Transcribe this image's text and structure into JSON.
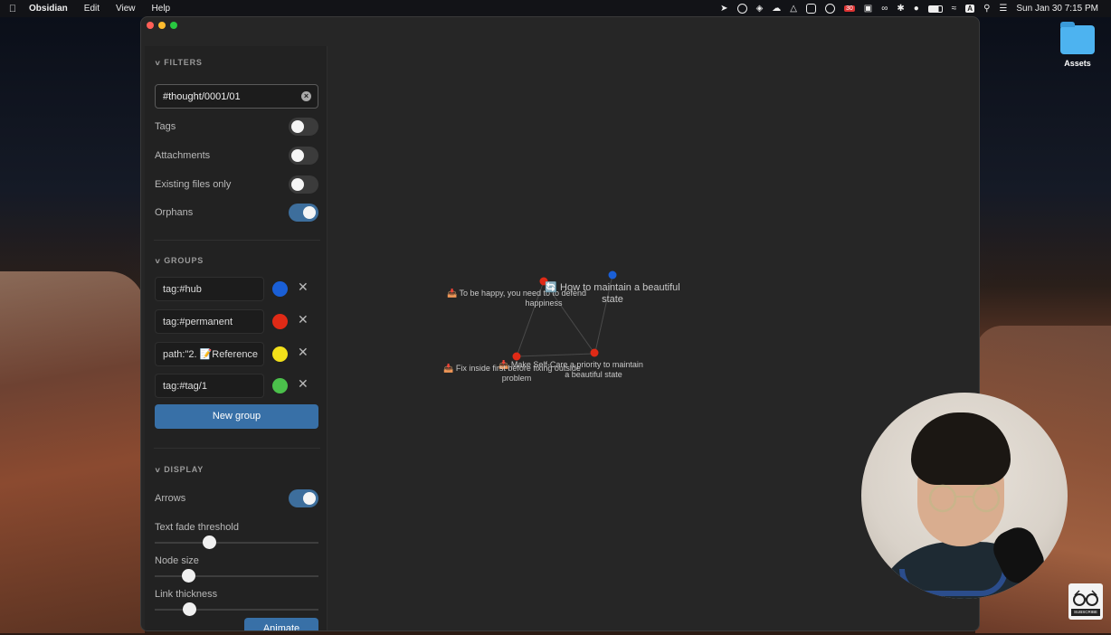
{
  "menubar": {
    "app_name": "Obsidian",
    "menus": [
      "Edit",
      "View",
      "Help"
    ],
    "status_icons": [
      "location-icon",
      "sync-icon",
      "wifi-hotspot-icon",
      "cloud-icon",
      "layers-icon",
      "drive-icon",
      "1password-icon",
      "calendar-icon",
      "messages-icon",
      "glasses-icon",
      "bluetooth-icon",
      "user-icon",
      "battery-icon",
      "wifi-icon",
      "input-source-icon",
      "search-icon",
      "control-center-icon"
    ],
    "calendar_day": "30",
    "input_source": "A",
    "datetime": "Sun Jan 30  7:15 PM"
  },
  "desktop": {
    "folder_label": "Assets"
  },
  "filters": {
    "header": "FILTERS",
    "search_value": "#thought/0001/01",
    "options": [
      {
        "label": "Tags",
        "on": false
      },
      {
        "label": "Attachments",
        "on": false
      },
      {
        "label": "Existing files only",
        "on": false
      },
      {
        "label": "Orphans",
        "on": true
      }
    ]
  },
  "groups": {
    "header": "GROUPS",
    "items": [
      {
        "query": "tag:#hub",
        "color": "#1a5fd6"
      },
      {
        "query": "tag:#permanent",
        "color": "#e02a16"
      },
      {
        "query": "path:\"2. 📝Reference",
        "color": "#f2e01a"
      },
      {
        "query": "tag:#tag/1",
        "color": "#4bc04b"
      }
    ],
    "new_group_label": "New group"
  },
  "display": {
    "header": "DISPLAY",
    "arrows_label": "Arrows",
    "arrows_on": true,
    "sliders": [
      {
        "label": "Text fade threshold",
        "value": 0.33
      },
      {
        "label": "Node size",
        "value": 0.2
      },
      {
        "label": "Link thickness",
        "value": 0.21
      }
    ],
    "animate_label": "Animate"
  },
  "graph": {
    "nodes": [
      {
        "label_lines": [
          "📥 To be happy, you need to to defend",
          "happiness"
        ],
        "color": "#e02a16"
      },
      {
        "label_lines": [
          "🔄 How to maintain a beautiful",
          "state"
        ],
        "color": "#1a5fd6"
      },
      {
        "label_lines": [
          "📥 Make Self-Care a priority to maintain",
          "a beautiful state"
        ],
        "color": "#e02a16"
      },
      {
        "label_lines": [
          "📥 Fix inside first before fixing outside",
          "problem"
        ],
        "color": "#e02a16"
      }
    ]
  },
  "overlay": {
    "subscribe_label": "SUBSCRIBE"
  }
}
